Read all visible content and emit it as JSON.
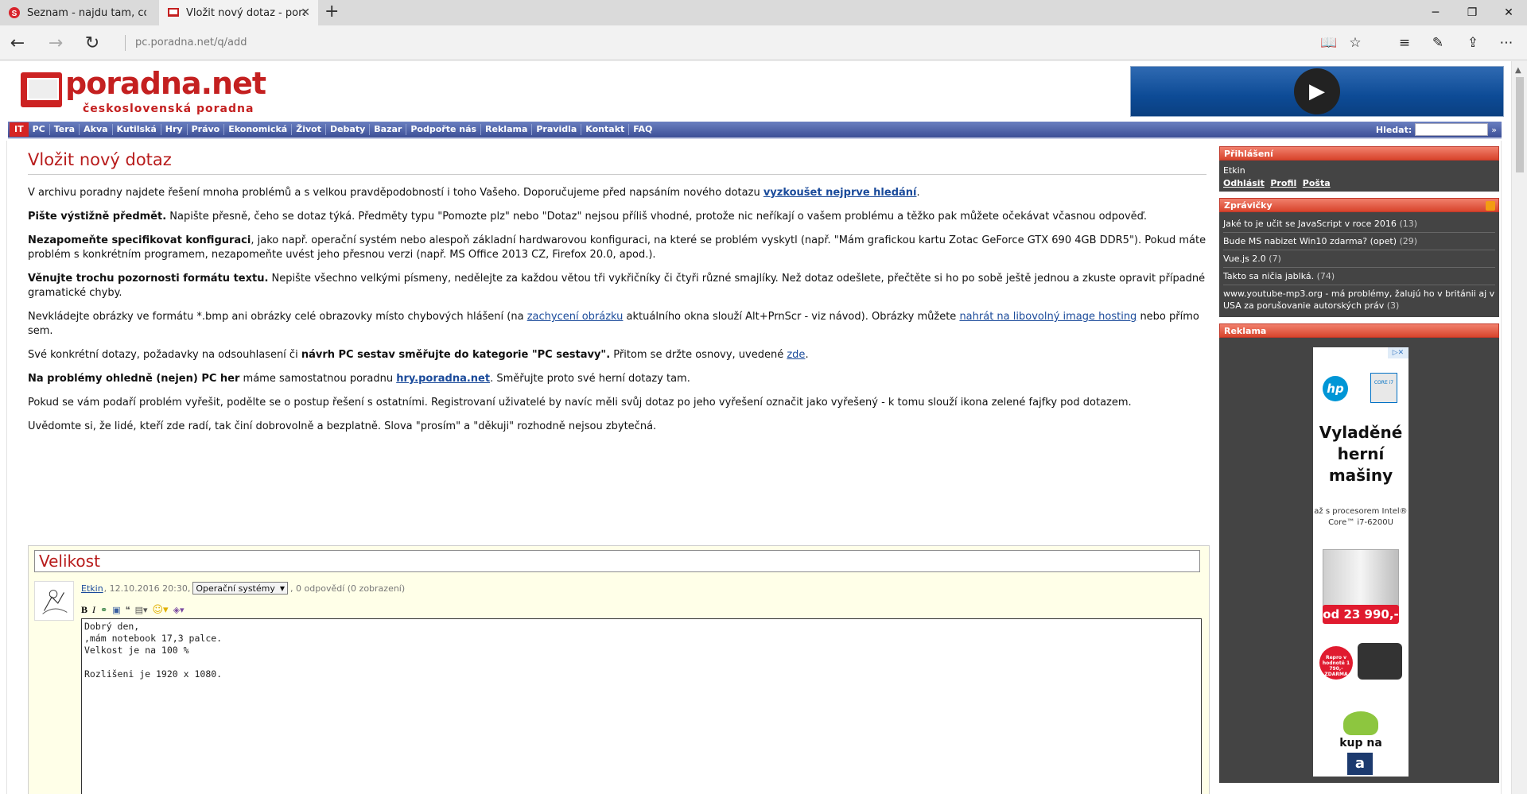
{
  "browser": {
    "tabs": [
      {
        "title": "Seznam - najdu tam, co nez",
        "active": false
      },
      {
        "title": "Vložit nový dotaz - pora",
        "active": true
      }
    ],
    "url": "pc.poradna.net/q/add"
  },
  "site": {
    "logo_name": "poradna.net",
    "logo_sub": "československá poradna"
  },
  "menu": {
    "it_label": "IT",
    "items": [
      "PC",
      "Tera",
      "Akva",
      "Kutilská",
      "Hry",
      "Právo",
      "Ekonomická",
      "Život",
      "Debaty",
      "Bazar",
      "Podpořte nás",
      "Reklama",
      "Pravidla",
      "Kontakt",
      "FAQ"
    ],
    "search_label": "Hledat:",
    "search_go": "»"
  },
  "main": {
    "title": "Vložit nový dotaz",
    "p1_text": "V archivu poradny najdete řešení mnoha problémů a s velkou pravděpodobností i toho Vašeho. Doporučujeme před napsáním nového dotazu ",
    "p1_link": "vyzkoušet nejprve hledání",
    "p1_end": ".",
    "p2_bold": "Pište výstižně předmět.",
    "p2_text": " Napište přesně, čeho se dotaz týká. Předměty typu \"Pomozte plz\" nebo \"Dotaz\" nejsou příliš vhodné, protože nic neříkají o vašem problému a těžko pak můžete očekávat včasnou odpověď.",
    "p3_bold": "Nezapomeňte specifikovat konfiguraci",
    "p3_text": ", jako např. operační systém nebo alespoň základní hardwarovou konfiguraci, na které se problém vyskytl (např. \"Mám grafickou kartu Zotac GeForce GTX 690 4GB DDR5\"). Pokud máte problém s konkrétním programem, nezapomeňte uvést jeho přesnou verzi (např. MS Office 2013 CZ, Firefox 20.0, apod.).",
    "p4_bold": "Věnujte trochu pozornosti formátu textu.",
    "p4_text": " Nepište všechno velkými písmeny, nedělejte za každou větou tři vykřičníky či čtyři různé smajlíky. Než dotaz odešlete, přečtěte si ho po sobě ještě jednou a zkuste opravit případné gramatické chyby.",
    "p5_a": "Nevkládejte obrázky ve formátu *.bmp ani obrázky celé obrazovky místo chybových hlášení (na ",
    "p5_link1": "zachycení obrázku",
    "p5_b": " aktuálního okna slouží Alt+PrnScr - viz návod). Obrázky můžete ",
    "p5_link2": "nahrát na libovolný image hosting",
    "p5_c": " nebo přímo sem.",
    "p6_a": "Své konkrétní dotazy, požadavky na odsouhlasení či ",
    "p6_bold": "návrh PC sestav směřujte do kategorie \"PC sestavy\".",
    "p6_b": " Přitom se držte osnovy, uvedené ",
    "p6_link": "zde",
    "p6_c": ".",
    "p7_bold": "Na problémy ohledně (nejen) PC her",
    "p7_a": " máme samostatnou poradnu ",
    "p7_link": "hry.poradna.net",
    "p7_b": ". Směřujte proto své herní dotazy tam.",
    "p8": "Pokud se vám podaří problém vyřešit, podělte se o postup řešení s ostatními. Registrovaní uživatelé by navíc měli svůj dotaz po jeho vyřešení označit jako vyřešený - k tomu slouží ikona zelené fajfky pod dotazem.",
    "p9": "Uvědomte si, že lidé, kteří zde radí, tak činí dobrovolně a bezplatně. Slova \"prosím\" a \"děkuji\" rozhodně nejsou zbytečná."
  },
  "question": {
    "subject": "Velikost",
    "author": "Etkin",
    "date": ", 12.10.2016 20:30,",
    "category": "Operační systémy",
    "stats": ", 0 odpovědí (0 zobrazení)",
    "body": "Dobrý den,\n,mám notebook 17,3 palce.\nVelkost je na 100 %\n\nRozlišeni je 1920 x 1080."
  },
  "sidebar": {
    "login_title": "Přihlášení",
    "login_user": "Etkin",
    "login_links": [
      "Odhlásit",
      "Profil",
      "Pošta"
    ],
    "news_title": "Zprávičky",
    "news": [
      {
        "text": "Jaké to je učit se JavaScript v roce 2016",
        "count": "(13)"
      },
      {
        "text": "Bude MS nabizet Win10 zdarma? (opet)",
        "count": "(29)"
      },
      {
        "text": "Vue.js 2.0",
        "count": "(7)"
      },
      {
        "text": "Takto sa ničia jablká.",
        "count": "(74)"
      },
      {
        "text": "www.youtube-mp3.org - má problémy, žalujú ho v británii aj v USA za porušovanie autorských práv",
        "count": "(3)"
      }
    ],
    "ad_title": "Reklama",
    "ad": {
      "hp": "hp",
      "intel": "CORE i7",
      "headline": "Vyladěné herní mašiny",
      "small": "až s procesorem Intel® Core™ i7-6200U",
      "price": "od 23 990,-",
      "promo": "Repro v hodnotě 1 790,- ZDARMA",
      "cta": "kup na",
      "alza": "a",
      "adchoice": "▷✕"
    }
  }
}
